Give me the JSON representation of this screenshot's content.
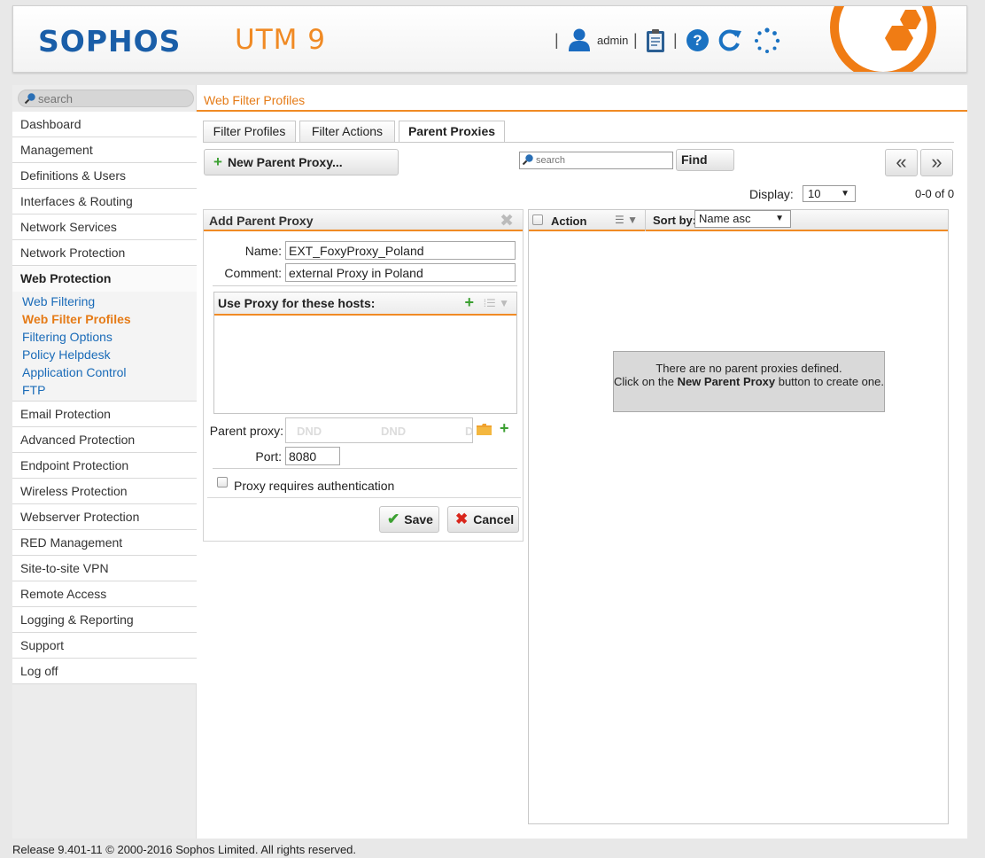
{
  "header": {
    "brand": "SOPHOS",
    "product": "UTM 9",
    "user": "admin",
    "accent_color": "#f08a24",
    "brand_color": "#1a5ea8"
  },
  "sidebar": {
    "search_placeholder": "search",
    "items": [
      {
        "label": "Dashboard"
      },
      {
        "label": "Management"
      },
      {
        "label": "Definitions & Users"
      },
      {
        "label": "Interfaces & Routing"
      },
      {
        "label": "Network Services"
      },
      {
        "label": "Network Protection"
      },
      {
        "label": "Web Protection"
      },
      {
        "label": "Email Protection"
      },
      {
        "label": "Advanced Protection"
      },
      {
        "label": "Endpoint Protection"
      },
      {
        "label": "Wireless Protection"
      },
      {
        "label": "Webserver Protection"
      },
      {
        "label": "RED Management"
      },
      {
        "label": "Site-to-site VPN"
      },
      {
        "label": "Remote Access"
      },
      {
        "label": "Logging & Reporting"
      },
      {
        "label": "Support"
      },
      {
        "label": "Log off"
      }
    ],
    "subitems": [
      {
        "label": "Web Filtering"
      },
      {
        "label": "Web Filter Profiles"
      },
      {
        "label": "Filtering Options"
      },
      {
        "label": "Policy Helpdesk"
      },
      {
        "label": "Application Control"
      },
      {
        "label": "FTP"
      }
    ]
  },
  "main": {
    "page_title": "Web Filter Profiles",
    "tabs": [
      {
        "label": "Filter Profiles"
      },
      {
        "label": "Filter Actions"
      },
      {
        "label": "Parent Proxies"
      }
    ],
    "new_button_label": "New Parent Proxy...",
    "search_placeholder": "search",
    "find_label": "Find",
    "pager_prev": "«",
    "pager_next": "»",
    "display_label": "Display:",
    "display_value": "10",
    "count_label": "0-0 of 0"
  },
  "add_panel": {
    "title": "Add Parent Proxy",
    "name_label": "Name:",
    "name_value": "EXT_FoxyProxy_Poland",
    "comment_label": "Comment:",
    "comment_value": "external Proxy in Poland",
    "hosts_title": "Use Proxy for these hosts:",
    "parent_proxy_label": "Parent proxy:",
    "dnd_text": "DND",
    "port_label": "Port:",
    "port_value": "8080",
    "auth_label": "Proxy requires authentication",
    "save_label": "Save",
    "cancel_label": "Cancel"
  },
  "list_panel": {
    "action_label": "Action",
    "sort_label": "Sort by:",
    "sort_value": "Name asc",
    "empty_line1": "There are no parent proxies defined.",
    "empty_line2_pre": "Click on the ",
    "empty_line2_bold": "New Parent Proxy",
    "empty_line2_post": " button to create one."
  },
  "footer": {
    "text": "Release 9.401-11  © 2000-2016 Sophos Limited. All rights reserved."
  }
}
